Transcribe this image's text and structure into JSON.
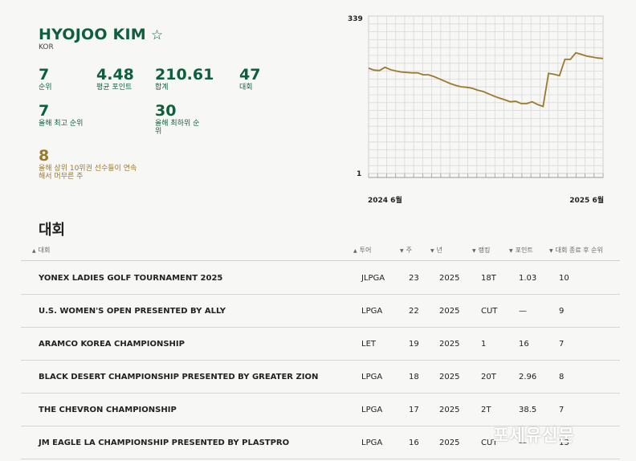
{
  "player": {
    "name": "HYOJOO KIM",
    "star": "☆",
    "country": "KOR"
  },
  "stats": [
    {
      "value": "7",
      "label": "순위"
    },
    {
      "value": "4.48",
      "label": "평균 포인트"
    },
    {
      "value": "210.61",
      "label": "합계"
    },
    {
      "value": "47",
      "label": "대회"
    },
    {
      "value": "7",
      "label": "올해 최고 순위"
    },
    {
      "value": "30",
      "label": "올해 최하위 순위"
    },
    {
      "value": "8",
      "label": "올해 상위 10위권 선수들이 연속해서 머무른 주"
    }
  ],
  "chart_data": {
    "type": "line",
    "y_top_label": "339",
    "y_bottom_label": "1",
    "ylim": [
      1,
      339
    ],
    "y_inverted": true,
    "x_start_label": "2024 6월",
    "x_end_label": "2025 6월",
    "grid": true,
    "line_color": "#9a7a2c",
    "values": [
      113,
      117,
      118,
      111,
      116,
      119,
      121,
      122,
      123,
      123,
      127,
      127,
      131,
      136,
      141,
      146,
      150,
      153,
      154,
      156,
      160,
      163,
      168,
      173,
      177,
      181,
      185,
      184,
      189,
      189,
      185,
      191,
      195,
      124,
      126,
      129,
      94,
      94,
      80,
      83,
      87,
      89,
      91,
      92
    ]
  },
  "section_title": "대회",
  "table": {
    "headers": [
      "대회",
      "투어",
      "주",
      "년",
      "랭킹",
      "포인트",
      "대회 종료 후 순위"
    ],
    "rows": [
      [
        "YONEX LADIES GOLF TOURNAMENT 2025",
        "JLPGA",
        "23",
        "2025",
        "18T",
        "1.03",
        "10"
      ],
      [
        "U.S. WOMEN'S OPEN PRESENTED BY ALLY",
        "LPGA",
        "22",
        "2025",
        "CUT",
        "—",
        "9"
      ],
      [
        "ARAMCO KOREA CHAMPIONSHIP",
        "LET",
        "19",
        "2025",
        "1",
        "16",
        "7"
      ],
      [
        "BLACK DESERT CHAMPIONSHIP PRESENTED BY GREATER ZION",
        "LPGA",
        "18",
        "2025",
        "20T",
        "2.96",
        "8"
      ],
      [
        "THE CHEVRON CHAMPIONSHIP",
        "LPGA",
        "17",
        "2025",
        "2T",
        "38.5",
        "7"
      ],
      [
        "JM EAGLE LA CHAMPIONSHIP PRESENTED BY PLASTPRO",
        "LPGA",
        "16",
        "2025",
        "CUT",
        "—",
        "13"
      ]
    ]
  },
  "watermark": "포세유신문"
}
